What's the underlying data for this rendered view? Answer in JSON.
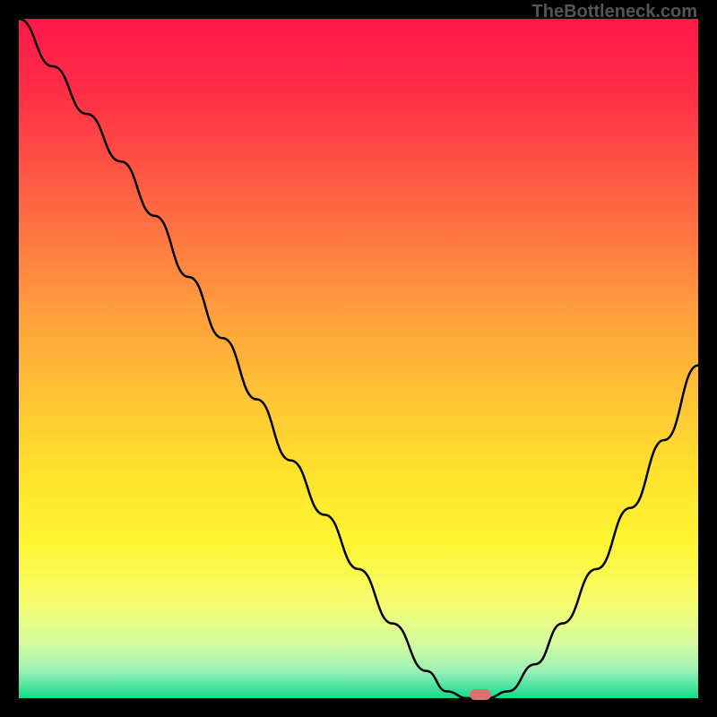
{
  "watermark": "TheBottleneck.com",
  "chart_data": {
    "type": "line",
    "title": "",
    "xlabel": "",
    "ylabel": "",
    "xlim": [
      0,
      100
    ],
    "ylim": [
      0,
      100
    ],
    "background_gradient": {
      "type": "vertical",
      "stops": [
        {
          "pos": 0.0,
          "color": "#ff1848"
        },
        {
          "pos": 0.11,
          "color": "#ff2e47"
        },
        {
          "pos": 0.22,
          "color": "#ff5344"
        },
        {
          "pos": 0.33,
          "color": "#ff7a41"
        },
        {
          "pos": 0.44,
          "color": "#ffa13c"
        },
        {
          "pos": 0.55,
          "color": "#ffc235"
        },
        {
          "pos": 0.66,
          "color": "#ffe02c"
        },
        {
          "pos": 0.77,
          "color": "#fff532"
        },
        {
          "pos": 0.86,
          "color": "#f7fc6e"
        },
        {
          "pos": 0.92,
          "color": "#d4fba0"
        },
        {
          "pos": 0.96,
          "color": "#9af1b5"
        },
        {
          "pos": 0.985,
          "color": "#43e29c"
        },
        {
          "pos": 1.0,
          "color": "#16d98a"
        }
      ]
    },
    "series": [
      {
        "name": "bottleneck-curve",
        "color": "#000000",
        "x": [
          0,
          5,
          10,
          15,
          20,
          25,
          30,
          35,
          40,
          45,
          50,
          55,
          60,
          63,
          66,
          69,
          72,
          76,
          80,
          85,
          90,
          95,
          100
        ],
        "y": [
          100,
          93,
          86,
          79,
          71,
          62,
          53,
          44,
          35,
          27,
          19,
          11,
          4,
          1,
          0,
          0,
          1,
          5,
          11,
          19,
          28,
          38,
          49
        ]
      }
    ],
    "marker": {
      "name": "optimal-point",
      "x": 68,
      "y": 0.5,
      "color": "#d6746f"
    }
  }
}
